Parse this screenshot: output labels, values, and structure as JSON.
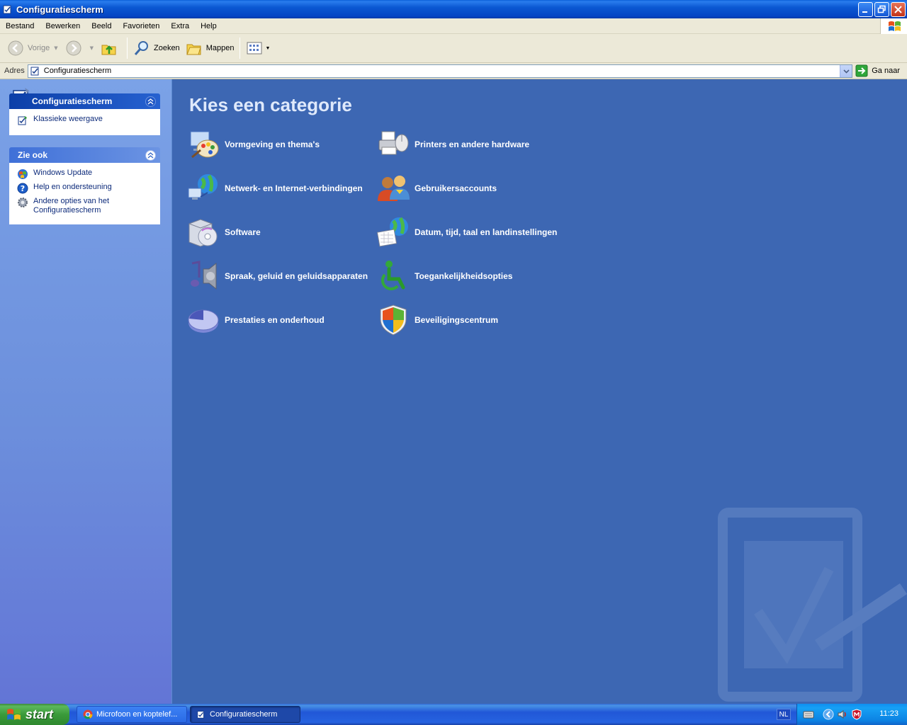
{
  "window": {
    "title": "Configuratiescherm"
  },
  "menubar": [
    "Bestand",
    "Bewerken",
    "Beeld",
    "Favorieten",
    "Extra",
    "Help"
  ],
  "toolbar": {
    "back_label": "Vorige",
    "search_label": "Zoeken",
    "folders_label": "Mappen"
  },
  "address": {
    "label": "Adres",
    "value": "Configuratiescherm",
    "go_label": "Ga naar"
  },
  "sidebar": {
    "control_panel": {
      "title": "Configuratiescherm",
      "items": [
        {
          "label": "Klassieke weergave",
          "icon": "classic-view-icon"
        }
      ]
    },
    "see_also": {
      "title": "Zie ook",
      "items": [
        {
          "label": "Windows Update",
          "icon": "windows-update-icon"
        },
        {
          "label": "Help en ondersteuning",
          "icon": "help-icon"
        },
        {
          "label": "Andere opties van het Configuratiescherm",
          "icon": "gear-icon"
        }
      ]
    }
  },
  "main": {
    "heading": "Kies een categorie",
    "categories": [
      {
        "label": "Vormgeving en thema's",
        "icon": "appearance-themes-icon"
      },
      {
        "label": "Printers en andere hardware",
        "icon": "printer-hardware-icon"
      },
      {
        "label": "Netwerk- en Internet-verbindingen",
        "icon": "network-internet-icon"
      },
      {
        "label": "Gebruikersaccounts",
        "icon": "user-accounts-icon"
      },
      {
        "label": "Software",
        "icon": "software-icon"
      },
      {
        "label": "Datum, tijd, taal en landinstellingen",
        "icon": "date-time-language-icon"
      },
      {
        "label": "Spraak, geluid en geluidsapparaten",
        "icon": "sound-speech-icon"
      },
      {
        "label": "Toegankelijkheidsopties",
        "icon": "accessibility-icon"
      },
      {
        "label": "Prestaties en onderhoud",
        "icon": "performance-maintenance-icon"
      },
      {
        "label": "Beveiligingscentrum",
        "icon": "security-center-icon"
      }
    ]
  },
  "taskbar": {
    "start_label": "start",
    "tasks": [
      {
        "label": "Microfoon en koptelef...",
        "icon": "chrome-icon",
        "active": false
      },
      {
        "label": "Configuratiescherm",
        "icon": "control-panel-icon",
        "active": true
      }
    ],
    "tray": {
      "language": "NL",
      "clock": "11:23"
    }
  },
  "colors": {
    "content_bg": "#3d67b3",
    "sidebar_bg": "#7ba2e7",
    "titlebar": "#0b58d2",
    "taskbar": "#2157d7",
    "start": "#3a9a3a"
  }
}
